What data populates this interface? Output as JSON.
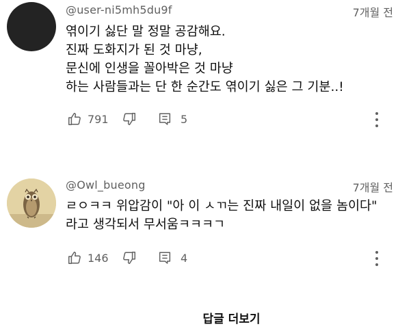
{
  "comments": [
    {
      "author": "@user-ni5mh5du9f",
      "time": "7개월 전",
      "lines": [
        "엮이기 싫단 말 정말 공감해요.",
        "진짜 도화지가 된 것 마냥,",
        "문신에 인생을 꼴아박은 것 마냥",
        "하는 사람들과는 단 한 순간도 엮이기 싫은 그 기분..!"
      ],
      "likes": "791",
      "replies": "5",
      "avatar_icon": "dark-circle-avatar"
    },
    {
      "author": "@Owl_bueong",
      "time": "7개월 전",
      "lines": [
        "ㄹㅇㅋㅋ 위압감이 \"아 이 ㅅㄲ는 진짜 내일이 없을 놈이다\"",
        "라고 생각되서 무서움ㅋㅋㅋㄱ"
      ],
      "likes": "146",
      "replies": "4",
      "avatar_icon": "owl-painting-avatar"
    }
  ],
  "more_replies_label": "답글 더보기",
  "icons": {
    "like": "thumbs-up-icon",
    "dislike": "thumbs-down-icon",
    "reply": "reply-comment-icon",
    "more": "vertical-dots-icon"
  },
  "colors": {
    "secondary_text": "#606060",
    "primary_text": "#0f0f0f"
  }
}
